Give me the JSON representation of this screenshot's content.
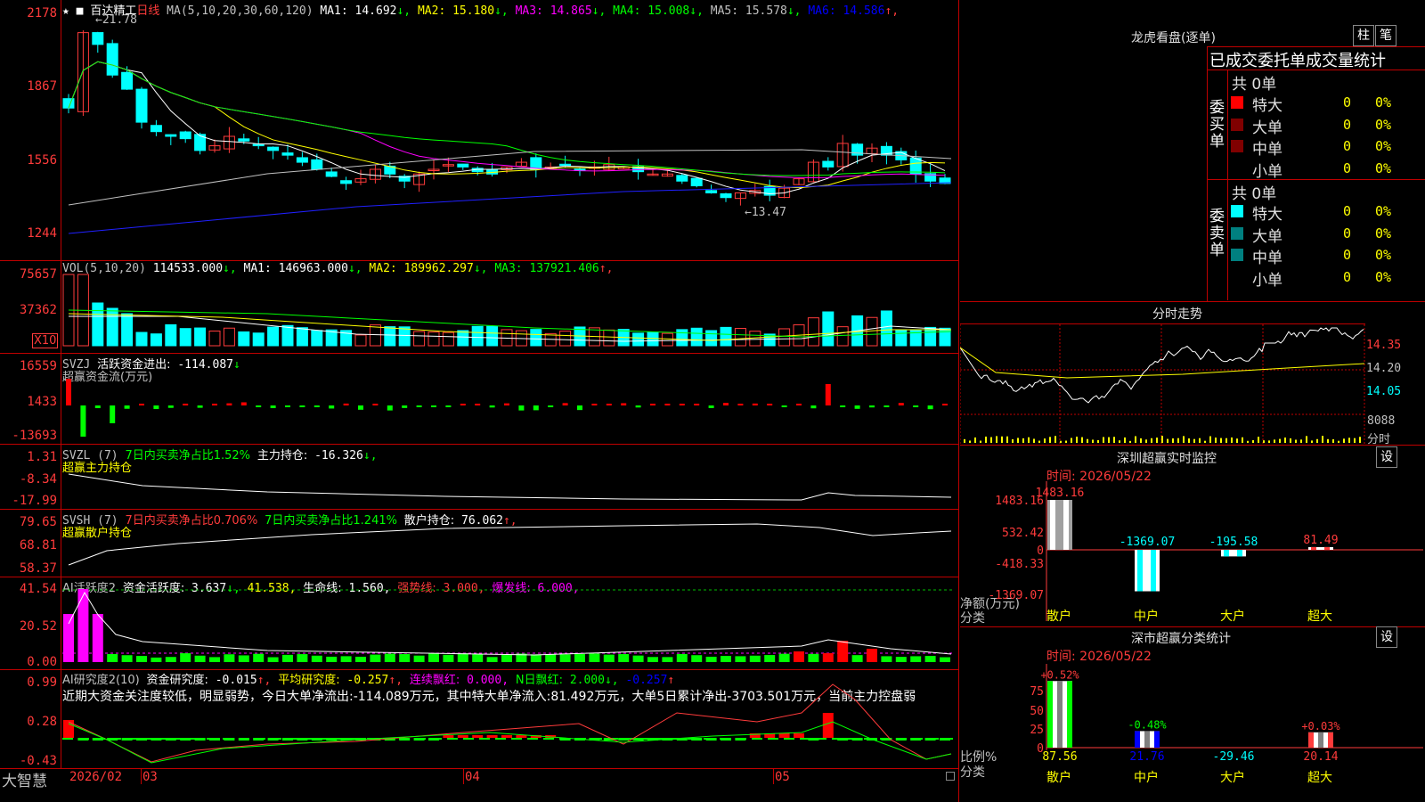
{
  "app": {
    "name": "大智慧"
  },
  "kline": {
    "stock": "百达精工",
    "period": "日线",
    "ma_title": "MA(5,10,20,30,60,120)",
    "ma": [
      {
        "label": "MA1:",
        "value": "14.692",
        "dir": "↓",
        "color": "#ffffff"
      },
      {
        "label": "MA2:",
        "value": "15.180",
        "dir": "↓",
        "color": "#ffff00"
      },
      {
        "label": "MA3:",
        "value": "14.865",
        "dir": "↓",
        "color": "#ff00ff"
      },
      {
        "label": "MA4:",
        "value": "15.008",
        "dir": "↓",
        "color": "#00ff00"
      },
      {
        "label": "MA5:",
        "value": "15.578",
        "dir": "↓",
        "color": "#c0c0c0"
      },
      {
        "label": "MA6:",
        "value": "14.586",
        "dir": "↑",
        "color": "#0000ff"
      }
    ],
    "y_ticks": [
      "2178",
      "1867",
      "1556",
      "1244"
    ],
    "high_mark": "21.78",
    "low_mark": "13.47",
    "stars": "★ ■"
  },
  "vol": {
    "title": "VOL(5,10,20)",
    "value": "114533.000",
    "ma": [
      {
        "label": "MA1:",
        "value": "146963.000",
        "dir": "↓",
        "color": "#ffffff"
      },
      {
        "label": "MA2:",
        "value": "189962.297",
        "dir": "↓",
        "color": "#ffff00"
      },
      {
        "label": "MA3:",
        "value": "137921.406",
        "dir": "↑",
        "color": "#00ff00"
      }
    ],
    "y_ticks": [
      "75657",
      "37362"
    ],
    "unit": "X10"
  },
  "svzj": {
    "title": "SVZJ",
    "item": "活跃资金进出:",
    "value": "-114.087",
    "dir": "↓",
    "subtitle": "超赢资金流(万元)",
    "y_ticks": [
      "16559",
      "1433",
      "-13693"
    ]
  },
  "svzl": {
    "title": "SVZL (7)",
    "item1": "7日内买卖净占比1.52%",
    "item2": "主力持仓:",
    "value": "-16.326",
    "dir": "↓,",
    "subtitle": "超赢主力持仓",
    "y_ticks": [
      "1.31",
      "-8.34",
      "-17.99"
    ]
  },
  "svsh": {
    "title": "SVSH (7)",
    "item1": "7日内买卖净占比0.706%",
    "item2": "7日内买卖净占比1.241%",
    "item3": "散户持仓:",
    "value": "76.062",
    "dir": "↑,",
    "subtitle": "超赢散户持仓",
    "y_ticks": [
      "79.65",
      "68.81",
      "58.37"
    ]
  },
  "ai1": {
    "title": "AI活跃度2",
    "i1": "资金活跃度:",
    "v1": "3.637",
    "d1": "↓,",
    "v2": "41.538,",
    "i3": "生命线:",
    "v3": "1.560,",
    "i4": "强势线:",
    "v4": "3.000,",
    "i5": "爆发线:",
    "v5": "6.000,",
    "y_ticks": [
      "41.54",
      "20.52",
      "0.00"
    ]
  },
  "ai2": {
    "title": "AI研究度2(10)",
    "i1": "资金研究度:",
    "v1": "-0.015",
    "d1": "↑,",
    "i2": "平均研究度:",
    "v2": "-0.257",
    "d2": "↑,",
    "i3": "连续飘红:",
    "v3": "0.000,",
    "i4": "N日飘红:",
    "v4": "2.000",
    "d4": "↓,",
    "v5": "-0.257",
    "d5": "↑",
    "comment": "近期大资金关注度较低，明显弱势，今日大单净流出:-114.089万元，其中特大单净流入:81.492万元，大单5日累计净出-3703.501万元，当前主力控盘弱",
    "y_ticks": [
      "0.99",
      "0.28",
      "-0.43"
    ]
  },
  "xaxis": {
    "labels": [
      "2026/02",
      "03",
      "04",
      "05"
    ]
  },
  "right": {
    "title": "龙虎看盘(逐单)",
    "btn1": "柱",
    "btn2": "笔",
    "stat_title": "已成交委托单成交量统计",
    "buy_label": "委买单",
    "sell_label": "委卖单",
    "buy_total": "共 0单",
    "sell_total": "共 0单",
    "buy_rows": [
      {
        "name": "特大",
        "count": "0",
        "pct": "0%",
        "color": "#ff0000"
      },
      {
        "name": "大单",
        "count": "0",
        "pct": "0%",
        "color": "#800000"
      },
      {
        "name": "中单",
        "count": "0",
        "pct": "0%",
        "color": "#800000"
      },
      {
        "name": "小单",
        "count": "0",
        "pct": "0%",
        "color": ""
      }
    ],
    "sell_rows": [
      {
        "name": "特大",
        "count": "0",
        "pct": "0%",
        "color": "#00ffff"
      },
      {
        "name": "大单",
        "count": "0",
        "pct": "0%",
        "color": "#008080"
      },
      {
        "name": "中单",
        "count": "0",
        "pct": "0%",
        "color": "#008080"
      },
      {
        "name": "小单",
        "count": "0",
        "pct": "0%",
        "color": ""
      }
    ],
    "fenshi": {
      "title": "分时走势",
      "prices": [
        "14.35",
        "14.20",
        "14.05"
      ],
      "vol_label": "8088",
      "vol_unit": "分时"
    },
    "sz_monitor": {
      "title": "深圳超赢实时监控",
      "set": "设",
      "time": "时间: 2026/05/22",
      "y_ticks": [
        "1483.16",
        "532.42",
        "0",
        "-418.33",
        "-1369.07"
      ],
      "unit": "净额(万元)",
      "cat_label": "分类",
      "categories": [
        "散户",
        "中户",
        "大户",
        "超大"
      ],
      "values": [
        "1483.16",
        "-1369.07",
        "-195.58",
        "81.49"
      ]
    },
    "sz_class": {
      "title": "深市超赢分类统计",
      "set": "设",
      "time": "时间: 2026/05/22",
      "y_ticks": [
        "75",
        "50",
        "25",
        "0"
      ],
      "unit": "比例%",
      "cat_label": "分类",
      "categories": [
        "散户",
        "中户",
        "大户",
        "超大"
      ],
      "changes": [
        "+0.52%",
        "-0.48%",
        "",
        "+0.03%"
      ],
      "values": [
        "87.56",
        "21.76",
        "-29.46",
        "20.14"
      ]
    }
  }
}
